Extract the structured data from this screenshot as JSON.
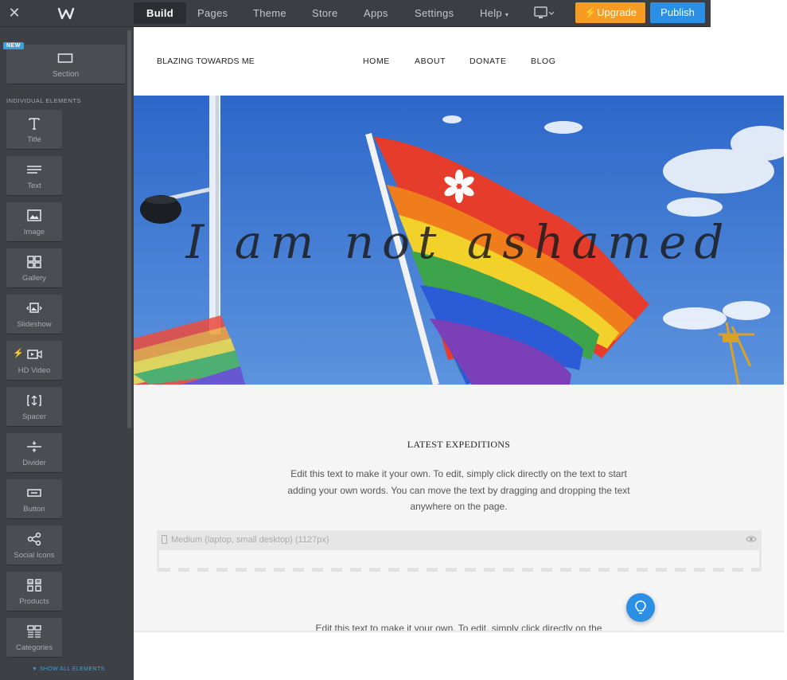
{
  "topbar": {
    "tabs": [
      {
        "label": "Build"
      },
      {
        "label": "Pages"
      },
      {
        "label": "Theme"
      },
      {
        "label": "Store"
      },
      {
        "label": "Apps"
      },
      {
        "label": "Settings"
      },
      {
        "label": "Help"
      }
    ],
    "help_caret": "▾",
    "upgrade_label": "Upgrade",
    "publish_label": "Publish",
    "colors": {
      "bar": "#3b3e42",
      "upgrade": "#f79c22",
      "publish": "#2b8fe5"
    }
  },
  "sidebar": {
    "new_badge": "NEW",
    "section_label": "Section",
    "group_label": "INDIVIDUAL ELEMENTS",
    "elements": [
      {
        "label": "Title",
        "icon": "title-icon"
      },
      {
        "label": "Text",
        "icon": "text-icon"
      },
      {
        "label": "Image",
        "icon": "image-icon"
      },
      {
        "label": "Gallery",
        "icon": "gallery-icon"
      },
      {
        "label": "Slideshow",
        "icon": "slideshow-icon"
      },
      {
        "label": "HD Video",
        "icon": "video-icon"
      },
      {
        "label": "Spacer",
        "icon": "spacer-icon"
      },
      {
        "label": "Divider",
        "icon": "divider-icon"
      },
      {
        "label": "Button",
        "icon": "button-icon"
      },
      {
        "label": "Social Icons",
        "icon": "social-icon"
      },
      {
        "label": "Products",
        "icon": "products-icon"
      },
      {
        "label": "Categories",
        "icon": "categories-icon"
      }
    ],
    "show_all": "SHOW ALL ELEMENTS"
  },
  "site": {
    "title": "BLAZING TOWARDS ME",
    "nav": [
      "HOME",
      "ABOUT",
      "DONATE",
      "BLOG"
    ],
    "hero_title": "I am not ashamed",
    "content_heading": "LATEST EXPEDITIONS",
    "content_body": "Edit this text to make it your own. To edit, simply click directly on the text to start adding your own words. You can move the text by dragging and dropping the text anywhere on the page.",
    "breakpoint_label": "Medium (laptop, small desktop) (1127px)",
    "content_body2": "Edit this text to make it your own. To edit, simply click directly on the"
  }
}
